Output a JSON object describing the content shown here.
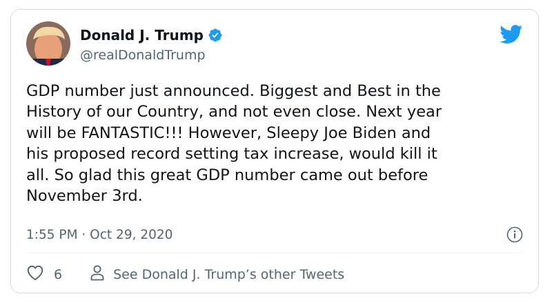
{
  "author": {
    "display_name": "Donald J. Trump",
    "handle": "@realDonaldTrump",
    "verified": true
  },
  "tweet": {
    "text": "GDP number just announced. Biggest and Best in the\nHistory of our Country, and not even close. Next year\nwill be FANTASTIC!!! However, Sleepy Joe Biden and\nhis proposed record setting tax increase, would kill it\nall. So glad this great GDP number came out before\nNovember 3rd.",
    "timestamp": "1:55 PM · Oct 29, 2020"
  },
  "actions": {
    "like_count": "6",
    "other_tweets_label": "See Donald J. Trump’s other Tweets"
  },
  "icons": {
    "brand": "twitter-bird-icon",
    "verified": "verified-badge-icon",
    "info": "info-icon",
    "like": "heart-icon",
    "profile": "person-icon"
  },
  "colors": {
    "brand_blue": "#1d9bf0",
    "text_primary": "#0f1419",
    "text_secondary": "#536471",
    "border": "#cfd9de"
  }
}
